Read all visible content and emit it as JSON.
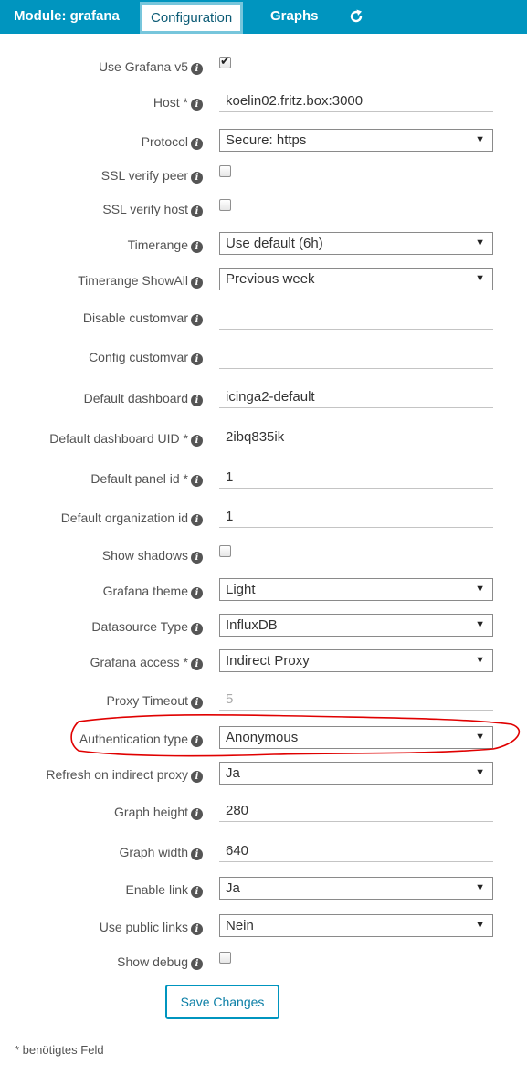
{
  "tabs": {
    "module": "Module: grafana",
    "configuration": "Configuration",
    "graphs": "Graphs"
  },
  "icons": {
    "refresh": "refresh-icon",
    "info": "info-icon",
    "dropdown": "chevron-down-icon"
  },
  "colors": {
    "tabbar": "#0095bf",
    "accent": "#0095bf",
    "annotation": "#e00000"
  },
  "form": {
    "use_grafana_v5": {
      "label": "Use Grafana v5",
      "checked": true
    },
    "host": {
      "label": "Host *",
      "value": "koelin02.fritz.box:3000"
    },
    "protocol": {
      "label": "Protocol",
      "value": "Secure: https"
    },
    "ssl_verify_peer": {
      "label": "SSL verify peer",
      "checked": false
    },
    "ssl_verify_host": {
      "label": "SSL verify host",
      "checked": false
    },
    "timerange": {
      "label": "Timerange",
      "value": "Use default (6h)"
    },
    "timerange_showall": {
      "label": "Timerange ShowAll",
      "value": "Previous week"
    },
    "disable_customvar": {
      "label": "Disable customvar",
      "value": ""
    },
    "config_customvar": {
      "label": "Config customvar",
      "value": ""
    },
    "default_dashboard": {
      "label": "Default dashboard",
      "value": "icinga2-default"
    },
    "default_dashboard_uid": {
      "label": "Default dashboard UID *",
      "value": "2ibq835ik"
    },
    "default_panel_id": {
      "label": "Default panel id *",
      "value": "1"
    },
    "default_org_id": {
      "label": "Default organization id",
      "value": "1"
    },
    "show_shadows": {
      "label": "Show shadows",
      "checked": false
    },
    "grafana_theme": {
      "label": "Grafana theme",
      "value": "Light"
    },
    "datasource_type": {
      "label": "Datasource Type",
      "value": "InfluxDB"
    },
    "grafana_access": {
      "label": "Grafana access *",
      "value": "Indirect Proxy"
    },
    "proxy_timeout": {
      "label": "Proxy Timeout",
      "placeholder": "5"
    },
    "authentication_type": {
      "label": "Authentication type",
      "value": "Anonymous"
    },
    "refresh_indirect_proxy": {
      "label": "Refresh on indirect proxy",
      "value": "Ja"
    },
    "graph_height": {
      "label": "Graph height",
      "value": "280"
    },
    "graph_width": {
      "label": "Graph width",
      "value": "640"
    },
    "enable_link": {
      "label": "Enable link",
      "value": "Ja"
    },
    "use_public_links": {
      "label": "Use public links",
      "value": "Nein"
    },
    "show_debug": {
      "label": "Show debug",
      "checked": false
    }
  },
  "save_button": "Save Changes",
  "required_note": "* benötigtes Feld"
}
